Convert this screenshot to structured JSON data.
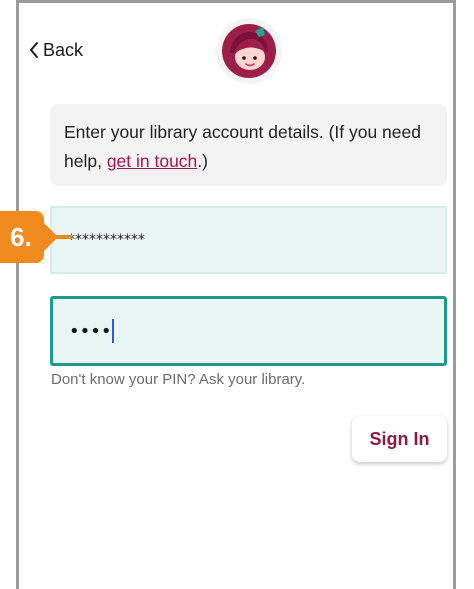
{
  "header": {
    "back_label": "Back"
  },
  "info": {
    "text_before_link": "Enter your library account details. (If you need help, ",
    "link_text": "get in touch",
    "text_after_link": ".)"
  },
  "form": {
    "barcode_value": "***********",
    "pin_value": "••••",
    "pin_help": "Don't know your PIN? Ask your library.",
    "sign_in_label": "Sign In"
  },
  "annotation": {
    "step_label": "6."
  },
  "colors": {
    "accent_teal": "#1e9a8c",
    "brand_magenta": "#8e1744",
    "link": "#a1154f",
    "callout_orange": "#f08a1c"
  },
  "icons": {
    "back": "chevron-left-icon",
    "app_logo": "libby-logo-icon"
  }
}
